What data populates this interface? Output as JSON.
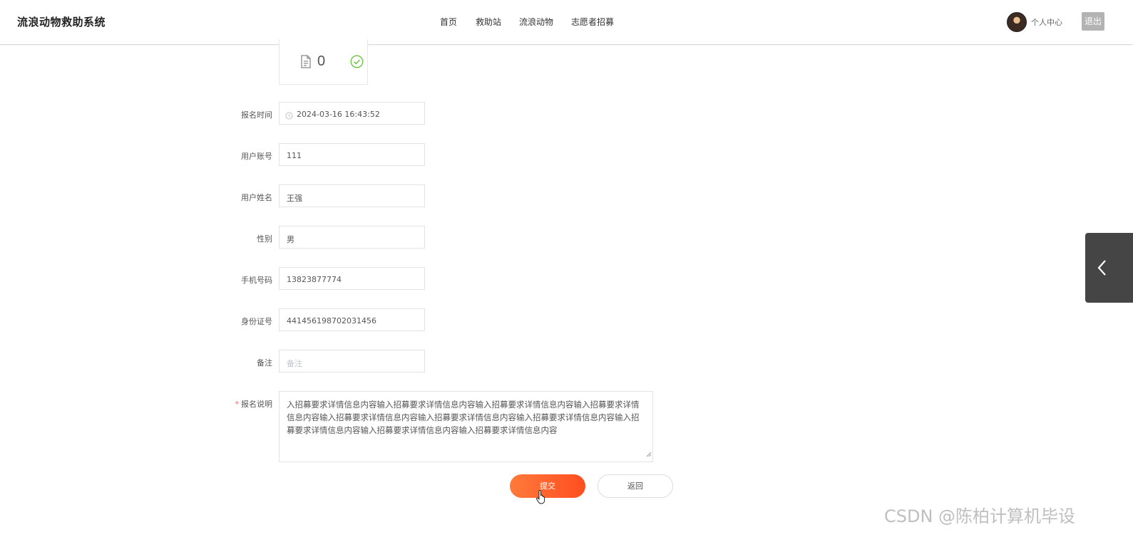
{
  "header": {
    "brand": "流浪动物救助系统",
    "nav": [
      "首页",
      "救助站",
      "流浪动物",
      "志愿者招募"
    ],
    "user_center": "个人中心",
    "logout": "退出"
  },
  "upload": {
    "count": "0"
  },
  "form": {
    "fields": [
      {
        "label": "报名时间",
        "value": "2024-03-16 16:43:52",
        "icon": "clock-icon"
      },
      {
        "label": "用户账号",
        "value": "111"
      },
      {
        "label": "用户姓名",
        "value": "王强"
      },
      {
        "label": "性别",
        "value": "男"
      },
      {
        "label": "手机号码",
        "value": "13823877774"
      },
      {
        "label": "身份证号",
        "value": "441456198702031456"
      },
      {
        "label": "备注",
        "value": "",
        "placeholder": "备注"
      }
    ],
    "description": {
      "required_mark": "*",
      "label": "报名说明",
      "value": "入招募要求详情信息内容输入招募要求详情信息内容输入招募要求详情信息内容输入招募要求详情信息内容输入招募要求详情信息内容输入招募要求详情信息内容输入招募要求详情信息内容输入招募要求详情信息内容输入招募要求详情信息内容输入招募要求详情信息内容"
    },
    "submit": "提交",
    "back": "返回"
  },
  "colors": {
    "submit_gradient_start": "#ff7a3b",
    "submit_gradient_end": "#ff4e1f",
    "success_check": "#67c23a",
    "side_toggle": "#454545"
  },
  "watermark": "CSDN @陈柏计算机毕设"
}
